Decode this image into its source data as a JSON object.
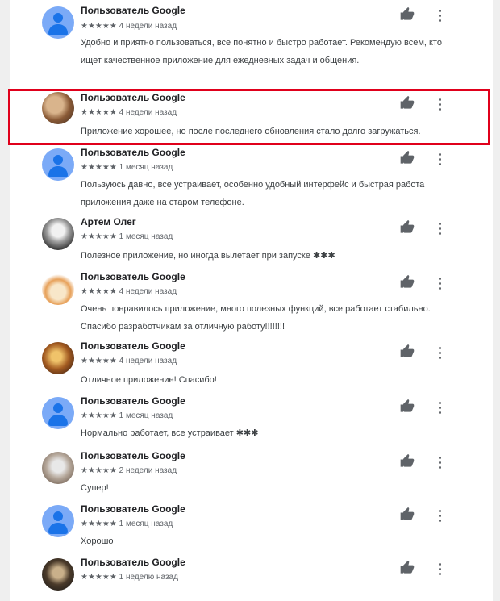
{
  "reviews": [
    {
      "author": "Пользователь Google",
      "meta": "★★★★★ 4 недели назад",
      "text": "Удобно и приятно пользоваться, все понятно и быстро работает. Рекомендую всем, кто ищет качественное приложение для ежедневных задач и общения.",
      "avatar": "default-avatar"
    },
    {
      "author": "Пользователь Google",
      "meta": "★★★★★ 4 недели назад",
      "text": "Приложение хорошее, но после последнего обновления стало долго загружаться.",
      "avatar": "photo-avatar"
    },
    {
      "author": "Пользователь Google",
      "meta": "★★★★★ 1 месяц назад",
      "text": "Пользуюсь давно, все устраивает, особенно удобный интерфейс и быстрая работа приложения даже на старом телефоне.",
      "avatar": "default-avatar"
    },
    {
      "author": "Артем Олег",
      "meta": "★★★★★ 1 месяц назад",
      "text": "Полезное приложение, но иногда вылетает при запуске ✱✱✱",
      "avatar": "photo-avatar"
    },
    {
      "author": "Пользователь Google",
      "meta": "★★★★★ 4 недели назад",
      "text": "Очень понравилось приложение, много полезных функций, все работает стабильно. Спасибо разработчикам за отличную работу!!!!!!!!",
      "avatar": "photo-avatar"
    },
    {
      "author": "Пользователь Google",
      "meta": "★★★★★ 4 недели назад",
      "text": "Отличное приложение! Спасибо!",
      "avatar": "photo-avatar"
    },
    {
      "author": "Пользователь Google",
      "meta": "★★★★★ 1 месяц назад",
      "text": "Нормально работает, все устраивает ✱✱✱",
      "avatar": "default-avatar"
    },
    {
      "author": "Пользователь Google",
      "meta": "★★★★★ 2 недели назад",
      "text": "Супер!",
      "avatar": "photo-avatar"
    },
    {
      "author": "Пользователь Google",
      "meta": "★★★★★ 1 месяц назад",
      "text": "Хорошо",
      "avatar": "default-avatar"
    },
    {
      "author": "Пользователь Google",
      "meta": "★★★★★ 1 неделю назад",
      "text": "",
      "avatar": "photo-avatar"
    }
  ],
  "colors": {
    "highlight": "#e0001b",
    "author": "#202124",
    "meta": "#5f6368"
  },
  "icons": {
    "like": "thumb-up-icon",
    "more": "more-vert-icon"
  }
}
